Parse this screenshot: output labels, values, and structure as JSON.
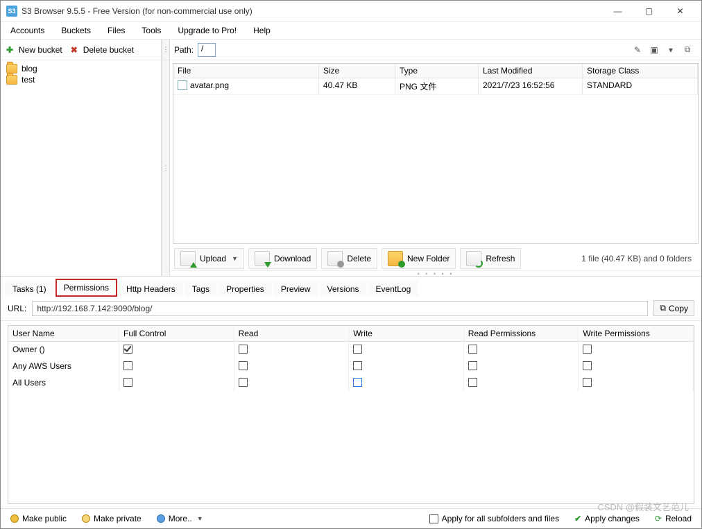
{
  "window": {
    "title": "S3 Browser 9.5.5 - Free Version (for non-commercial use only)"
  },
  "menu": {
    "accounts": "Accounts",
    "buckets": "Buckets",
    "files": "Files",
    "tools": "Tools",
    "upgrade": "Upgrade to Pro!",
    "help": "Help"
  },
  "bucket_ops": {
    "new": "New bucket",
    "delete": "Delete bucket"
  },
  "path": {
    "label": "Path:",
    "value": "/"
  },
  "tree": {
    "items": [
      "blog",
      "test"
    ]
  },
  "file_table": {
    "headers": {
      "file": "File",
      "size": "Size",
      "type": "Type",
      "modified": "Last Modified",
      "storage": "Storage Class"
    },
    "rows": [
      {
        "file": "avatar.png",
        "size": "40.47 KB",
        "type": "PNG 文件",
        "modified": "2021/7/23 16:52:56",
        "storage": "STANDARD"
      }
    ],
    "toolbar": {
      "upload": "Upload",
      "download": "Download",
      "delete": "Delete",
      "new_folder": "New Folder",
      "refresh": "Refresh"
    },
    "status": "1 file (40.47 KB) and 0 folders"
  },
  "tabs": {
    "tasks": "Tasks (1)",
    "permissions": "Permissions",
    "http": "Http Headers",
    "tags": "Tags",
    "properties": "Properties",
    "preview": "Preview",
    "versions": "Versions",
    "eventlog": "EventLog"
  },
  "url": {
    "label": "URL:",
    "value": "http://192.168.7.142:9090/blog/",
    "copy": "Copy"
  },
  "perm": {
    "headers": {
      "user": "User Name",
      "full": "Full Control",
      "read": "Read",
      "write": "Write",
      "readp": "Read Permissions",
      "writep": "Write Permissions"
    },
    "rows": [
      {
        "name": "Owner ()",
        "full": true,
        "read": false,
        "write": false,
        "readp": false,
        "writep": false,
        "hl": ""
      },
      {
        "name": "Any AWS Users",
        "full": false,
        "read": false,
        "write": false,
        "readp": false,
        "writep": false,
        "hl": ""
      },
      {
        "name": "All Users",
        "full": false,
        "read": false,
        "write": false,
        "readp": false,
        "writep": false,
        "hl": "write"
      }
    ]
  },
  "bottom": {
    "public": "Make public",
    "private": "Make private",
    "more": "More..",
    "apply_all": "Apply for all subfolders and files",
    "apply": "Apply changes",
    "reload": "Reload"
  },
  "watermark": "CSDN @假装文艺范儿"
}
